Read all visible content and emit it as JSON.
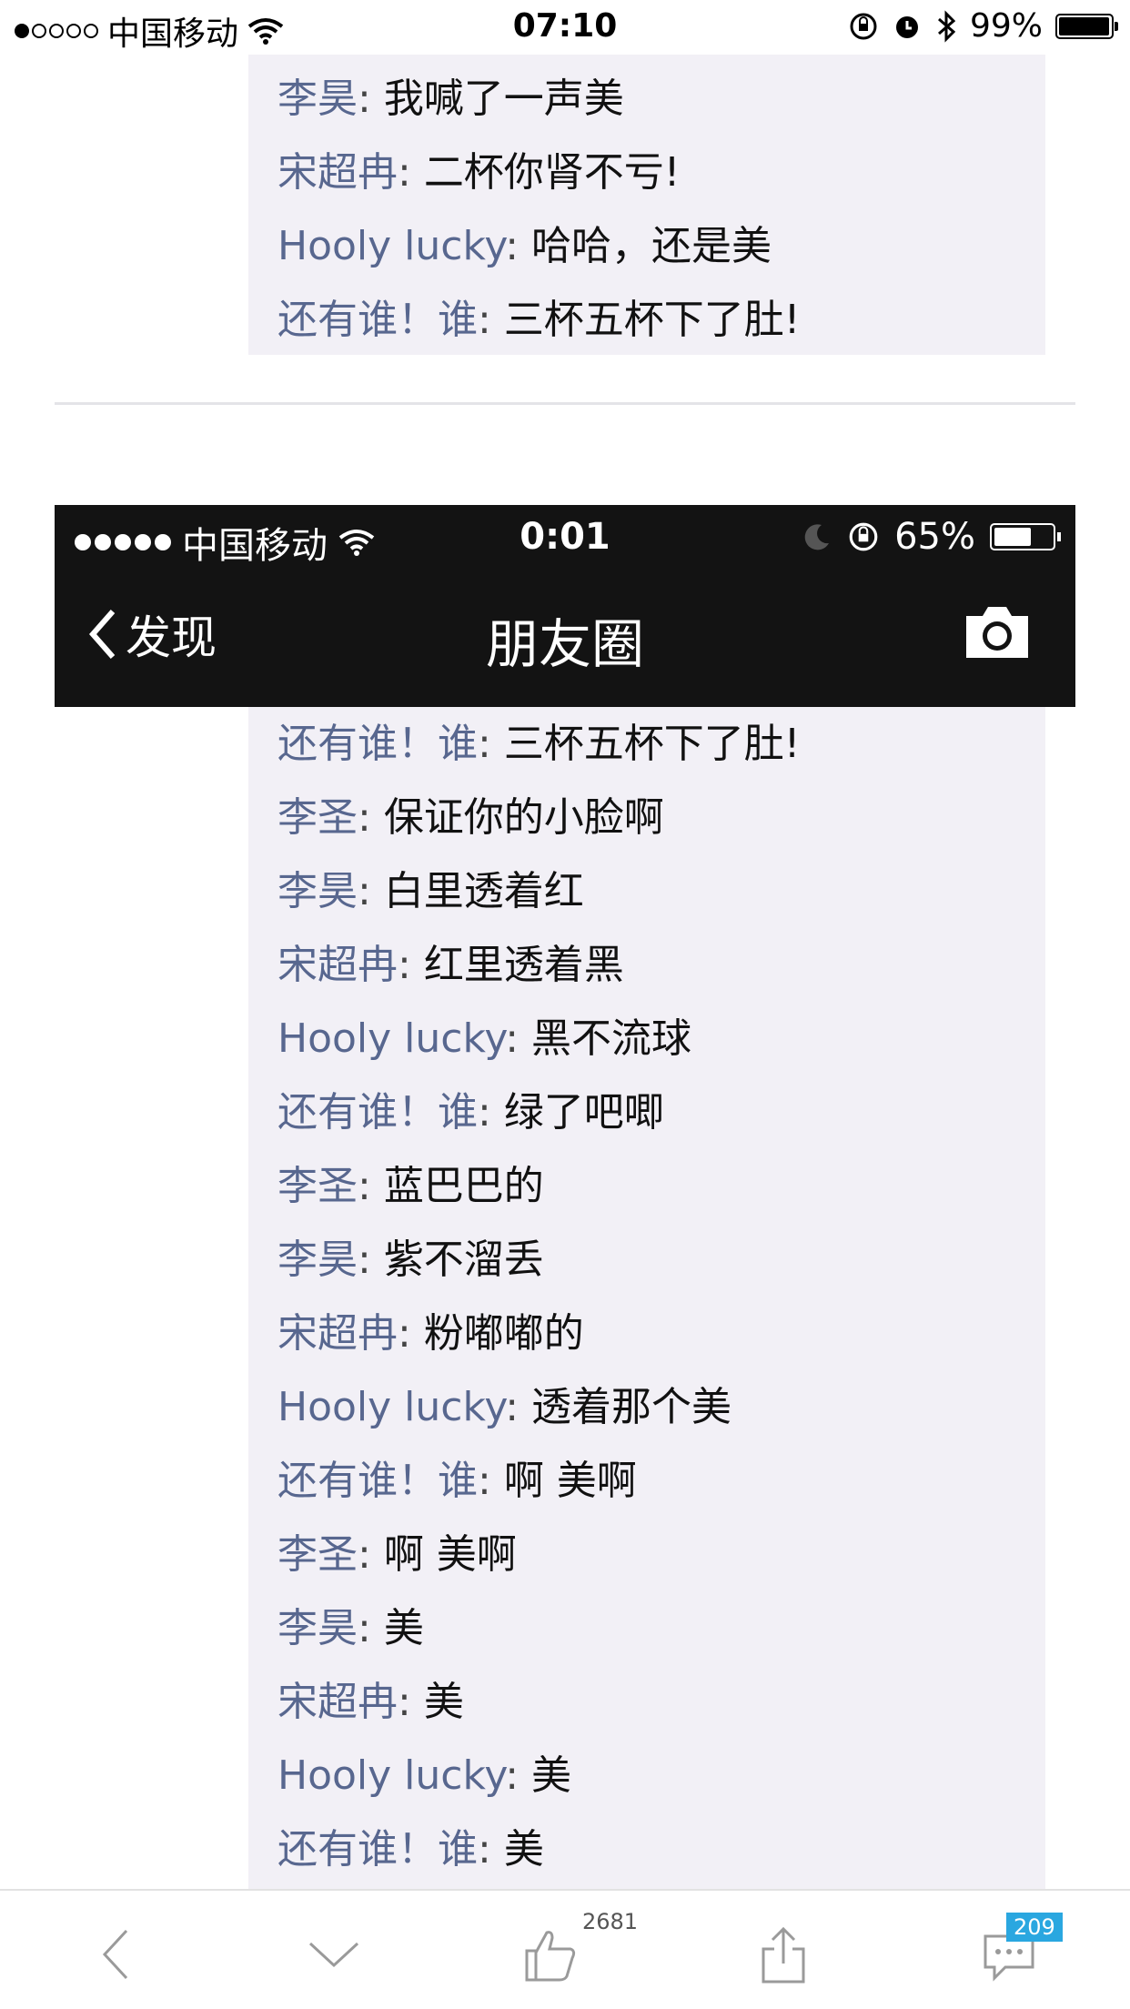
{
  "status_bar": {
    "carrier": "中国移动",
    "time": "07:10",
    "battery": "99%",
    "battery_level": 0.99
  },
  "top_chat": [
    {
      "name": "李昊",
      "text": "我喊了一声美"
    },
    {
      "name": "宋超冉",
      "text": "二杯你肾不亏!"
    },
    {
      "name": "Hooly lucky",
      "text": "哈哈，还是美"
    },
    {
      "name": "还有谁！谁",
      "text": "三杯五杯下了肚!"
    }
  ],
  "inner_screenshot": {
    "carrier": "中国移动",
    "time": "0:01",
    "battery": "65%",
    "battery_level": 0.65,
    "back_label": "发现",
    "title": "朋友圈"
  },
  "main_chat": [
    {
      "name": "还有谁！谁",
      "text": "三杯五杯下了肚!"
    },
    {
      "name": "李圣",
      "text": "保证你的小脸啊"
    },
    {
      "name": "李昊",
      "text": "白里透着红"
    },
    {
      "name": "宋超冉",
      "text": "红里透着黑"
    },
    {
      "name": "Hooly lucky",
      "text": "黑不流球"
    },
    {
      "name": "还有谁！谁",
      "text": "绿了吧唧"
    },
    {
      "name": "李圣",
      "text": "蓝巴巴的"
    },
    {
      "name": "李昊",
      "text": "紫不溜丢"
    },
    {
      "name": "宋超冉",
      "text": "粉嘟嘟的"
    },
    {
      "name": "Hooly lucky",
      "text": "透着那个美"
    },
    {
      "name": "还有谁！谁",
      "text": "啊 美啊"
    },
    {
      "name": "李圣",
      "text": "啊 美啊"
    },
    {
      "name": "李昊",
      "text": "美"
    },
    {
      "name": "宋超冉",
      "text": "美"
    },
    {
      "name": "Hooly lucky",
      "text": "美"
    },
    {
      "name": "还有谁！谁",
      "text": "美"
    }
  ],
  "toolbar": {
    "like_count": "2681",
    "comment_count": "209"
  },
  "colors": {
    "name_color": "#58678f",
    "chat_bg": "#f2f0f6",
    "badge": "#2aa7e0"
  }
}
